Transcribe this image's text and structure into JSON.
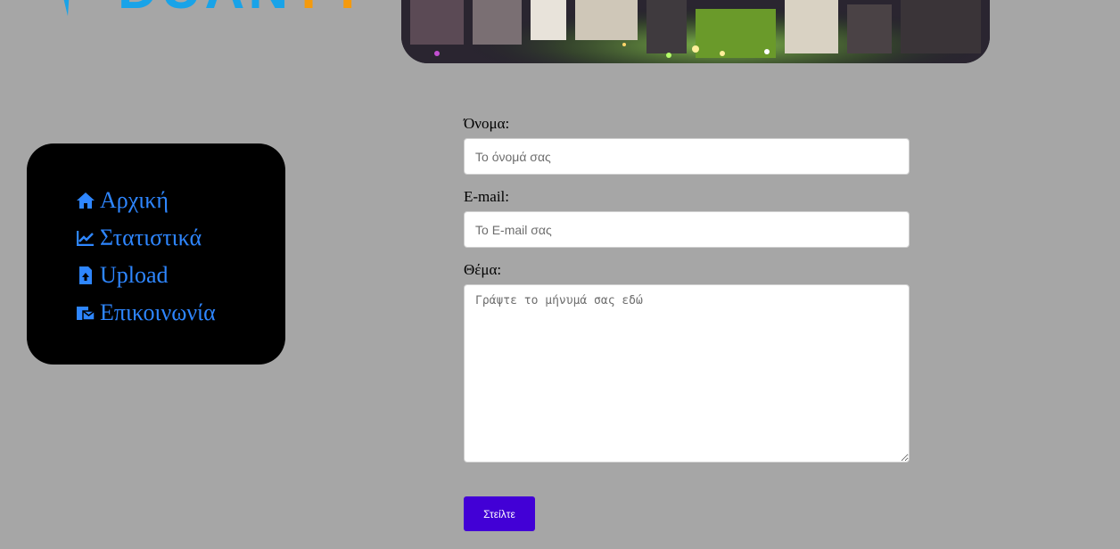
{
  "colors": {
    "page_background": "#a6a6a6",
    "sidebar_background": "#000000",
    "nav_link": "#2e86ff",
    "submit_button": "#4200d6",
    "logo_blue": "#19a3e8",
    "logo_orange": "#f59a0c"
  },
  "sidebar": {
    "items": [
      {
        "label": "Αρχική",
        "icon": "home-icon"
      },
      {
        "label": "Στατιστικά",
        "icon": "line-chart-icon"
      },
      {
        "label": "Upload",
        "icon": "file-upload-icon"
      },
      {
        "label": "Επικοινωνία",
        "icon": "contact-mail-icon"
      }
    ]
  },
  "form": {
    "name_label": "Όνομα:",
    "name_placeholder": "Το όνομά σας",
    "email_label": "E-mail:",
    "email_placeholder": "Το E-mail σας",
    "subject_label": "Θέμα:",
    "message_placeholder": "Γράψτε το μήνυμά σας εδώ",
    "submit_label": "Στείλτε"
  }
}
